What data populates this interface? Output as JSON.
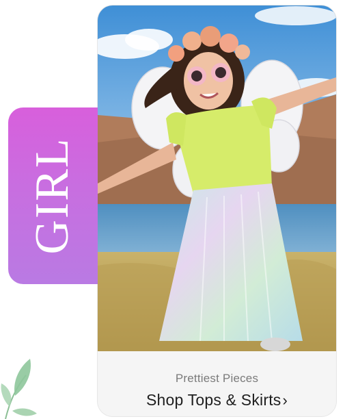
{
  "category_tag": {
    "label": "GIRL",
    "gradient_top": "#d85fdc",
    "gradient_bottom": "#b97ae3"
  },
  "card": {
    "image_icon": "girl-in-pastel-skirt-photo",
    "subtitle": "Prettiest Pieces",
    "cta_label": "Shop Tops & Skirts",
    "cta_chevron": "›"
  },
  "decoration": {
    "icon": "green-leaf-icon",
    "color": "#7fb58a"
  }
}
